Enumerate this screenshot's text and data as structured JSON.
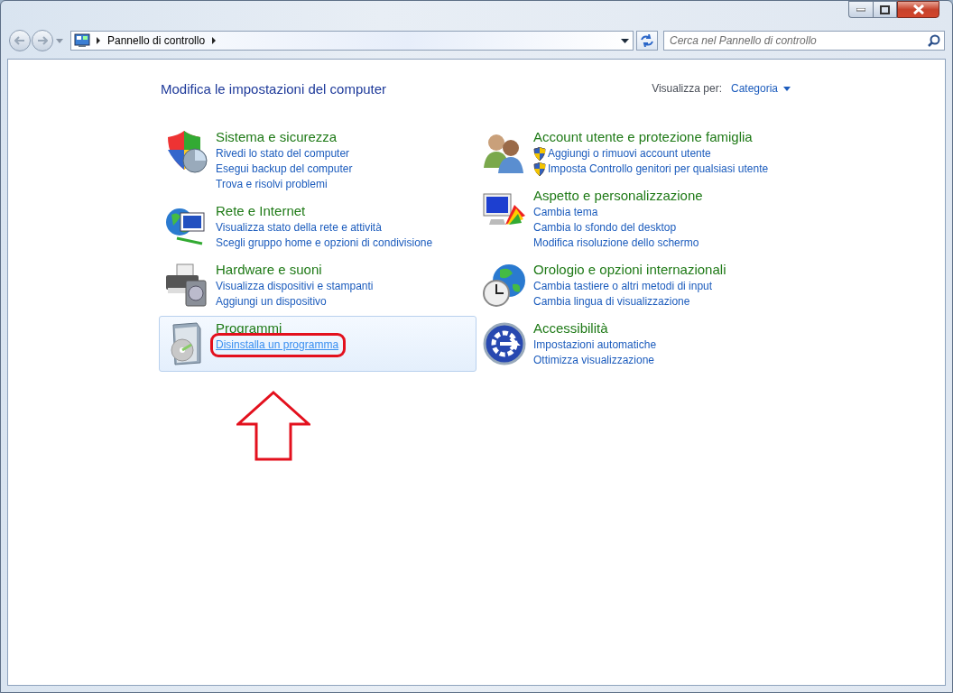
{
  "address_bar": {
    "location": "Pannello di controllo"
  },
  "search": {
    "placeholder": "Cerca nel Pannello di controllo"
  },
  "page_title": "Modifica le impostazioni del computer",
  "view_by": {
    "label": "Visualizza per:",
    "value": "Categoria"
  },
  "columns": [
    {
      "categories": [
        {
          "title": "Sistema e sicurezza",
          "highlighted": false,
          "links": [
            {
              "text": "Rivedi lo stato del computer",
              "shield": false,
              "hovered": false,
              "circled": false
            },
            {
              "text": "Esegui backup del computer",
              "shield": false,
              "hovered": false,
              "circled": false
            },
            {
              "text": "Trova e risolvi problemi",
              "shield": false,
              "hovered": false,
              "circled": false
            }
          ]
        },
        {
          "title": "Rete e Internet",
          "highlighted": false,
          "links": [
            {
              "text": "Visualizza stato della rete e attività",
              "shield": false,
              "hovered": false,
              "circled": false
            },
            {
              "text": "Scegli gruppo home e opzioni di condivisione",
              "shield": false,
              "hovered": false,
              "circled": false
            }
          ]
        },
        {
          "title": "Hardware e suoni",
          "highlighted": false,
          "links": [
            {
              "text": "Visualizza dispositivi e stampanti",
              "shield": false,
              "hovered": false,
              "circled": false
            },
            {
              "text": "Aggiungi un dispositivo",
              "shield": false,
              "hovered": false,
              "circled": false
            }
          ]
        },
        {
          "title": "Programmi",
          "highlighted": true,
          "links": [
            {
              "text": "Disinstalla un programma",
              "shield": false,
              "hovered": true,
              "circled": true
            }
          ]
        }
      ]
    },
    {
      "categories": [
        {
          "title": "Account utente e protezione famiglia",
          "highlighted": false,
          "links": [
            {
              "text": "Aggiungi o rimuovi account utente",
              "shield": true,
              "hovered": false,
              "circled": false
            },
            {
              "text": "Imposta Controllo genitori per qualsiasi utente",
              "shield": true,
              "hovered": false,
              "circled": false
            }
          ]
        },
        {
          "title": "Aspetto e personalizzazione",
          "highlighted": false,
          "links": [
            {
              "text": "Cambia tema",
              "shield": false,
              "hovered": false,
              "circled": false
            },
            {
              "text": "Cambia lo sfondo del desktop",
              "shield": false,
              "hovered": false,
              "circled": false
            },
            {
              "text": "Modifica risoluzione dello schermo",
              "shield": false,
              "hovered": false,
              "circled": false
            }
          ]
        },
        {
          "title": "Orologio e opzioni internazionali",
          "highlighted": false,
          "links": [
            {
              "text": "Cambia tastiere o altri metodi di input",
              "shield": false,
              "hovered": false,
              "circled": false
            },
            {
              "text": "Cambia lingua di visualizzazione",
              "shield": false,
              "hovered": false,
              "circled": false
            }
          ]
        },
        {
          "title": "Accessibilità",
          "highlighted": false,
          "links": [
            {
              "text": "Impostazioni automatiche",
              "shield": false,
              "hovered": false,
              "circled": false
            },
            {
              "text": "Ottimizza visualizzazione",
              "shield": false,
              "hovered": false,
              "circled": false
            }
          ]
        }
      ]
    }
  ]
}
